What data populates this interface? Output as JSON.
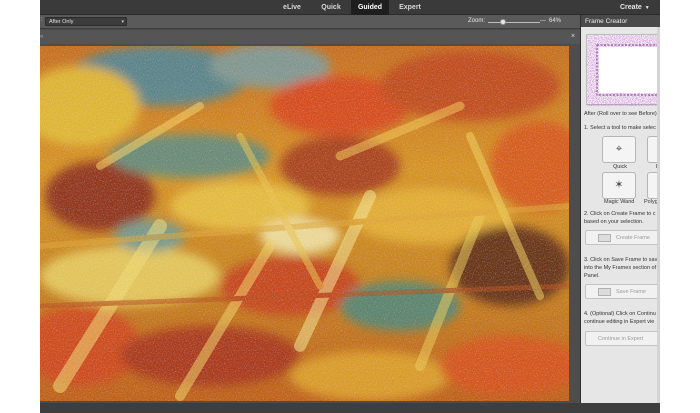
{
  "modes": [
    {
      "label": "eLive",
      "active": false
    },
    {
      "label": "Quick",
      "active": false
    },
    {
      "label": "Guided",
      "active": true
    },
    {
      "label": "Expert",
      "active": false
    }
  ],
  "create": {
    "label": "Create",
    "icon": "chevron-down-icon"
  },
  "options": {
    "colon": ":",
    "view_select": "After Only",
    "view_caret": "▾",
    "zoom_label": "Zoom:",
    "zoom_minus": "—",
    "zoom_value": "64%",
    "zoom_level": 0.64
  },
  "document": {
    "corner": "«",
    "close_glyph": "×",
    "image_subject": "abstract painted texture in orange, yellow, red and teal"
  },
  "panel": {
    "title": "Frame Creator",
    "preview_caption": "After (Roll over to see Before)",
    "step1": "1. Select a tool to make selec",
    "tools": [
      {
        "label": "Quick",
        "icon": "quick-selection-icon",
        "glyph": "⌖"
      },
      {
        "label": "B",
        "icon": "brush-icon",
        "glyph": "⌖"
      },
      {
        "label": "Magic Wand",
        "icon": "magic-wand-icon",
        "glyph": "✶"
      },
      {
        "label": "Polyg",
        "icon": "polygonal-lasso-icon",
        "glyph": "⌁"
      }
    ],
    "step2_line1": "2. Click on Create Frame to c",
    "step2_line2": "based on your selection.",
    "create_frame": "Create Frame",
    "step3_line1": "3. Click on Save Frame to sav",
    "step3_line2": "into the My Frames section of",
    "step3_line3": "Panel.",
    "save_frame": "Save Frame",
    "step4_line1": "4. (Optional) Click on Continu",
    "step4_line2": "continue editing in Expert vie",
    "continue_expert": "Continue in Expert"
  },
  "colors": {
    "frame_purple": "#7a2a8c",
    "active_tab": "#1e1e1e",
    "panel_bg": "#e6e6e6"
  }
}
